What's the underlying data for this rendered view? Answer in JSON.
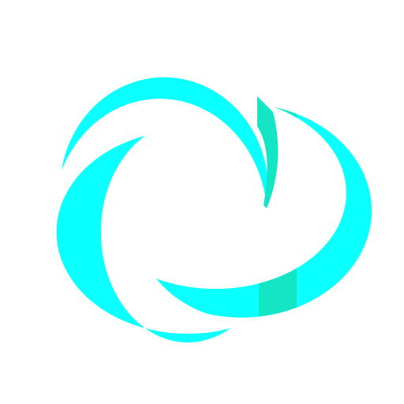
{
  "logo": {
    "icon": "three-crescent-swirl-icon",
    "colors": {
      "background": "#ffffff",
      "primary": "#0affff",
      "accent": "#14e5c4"
    }
  }
}
